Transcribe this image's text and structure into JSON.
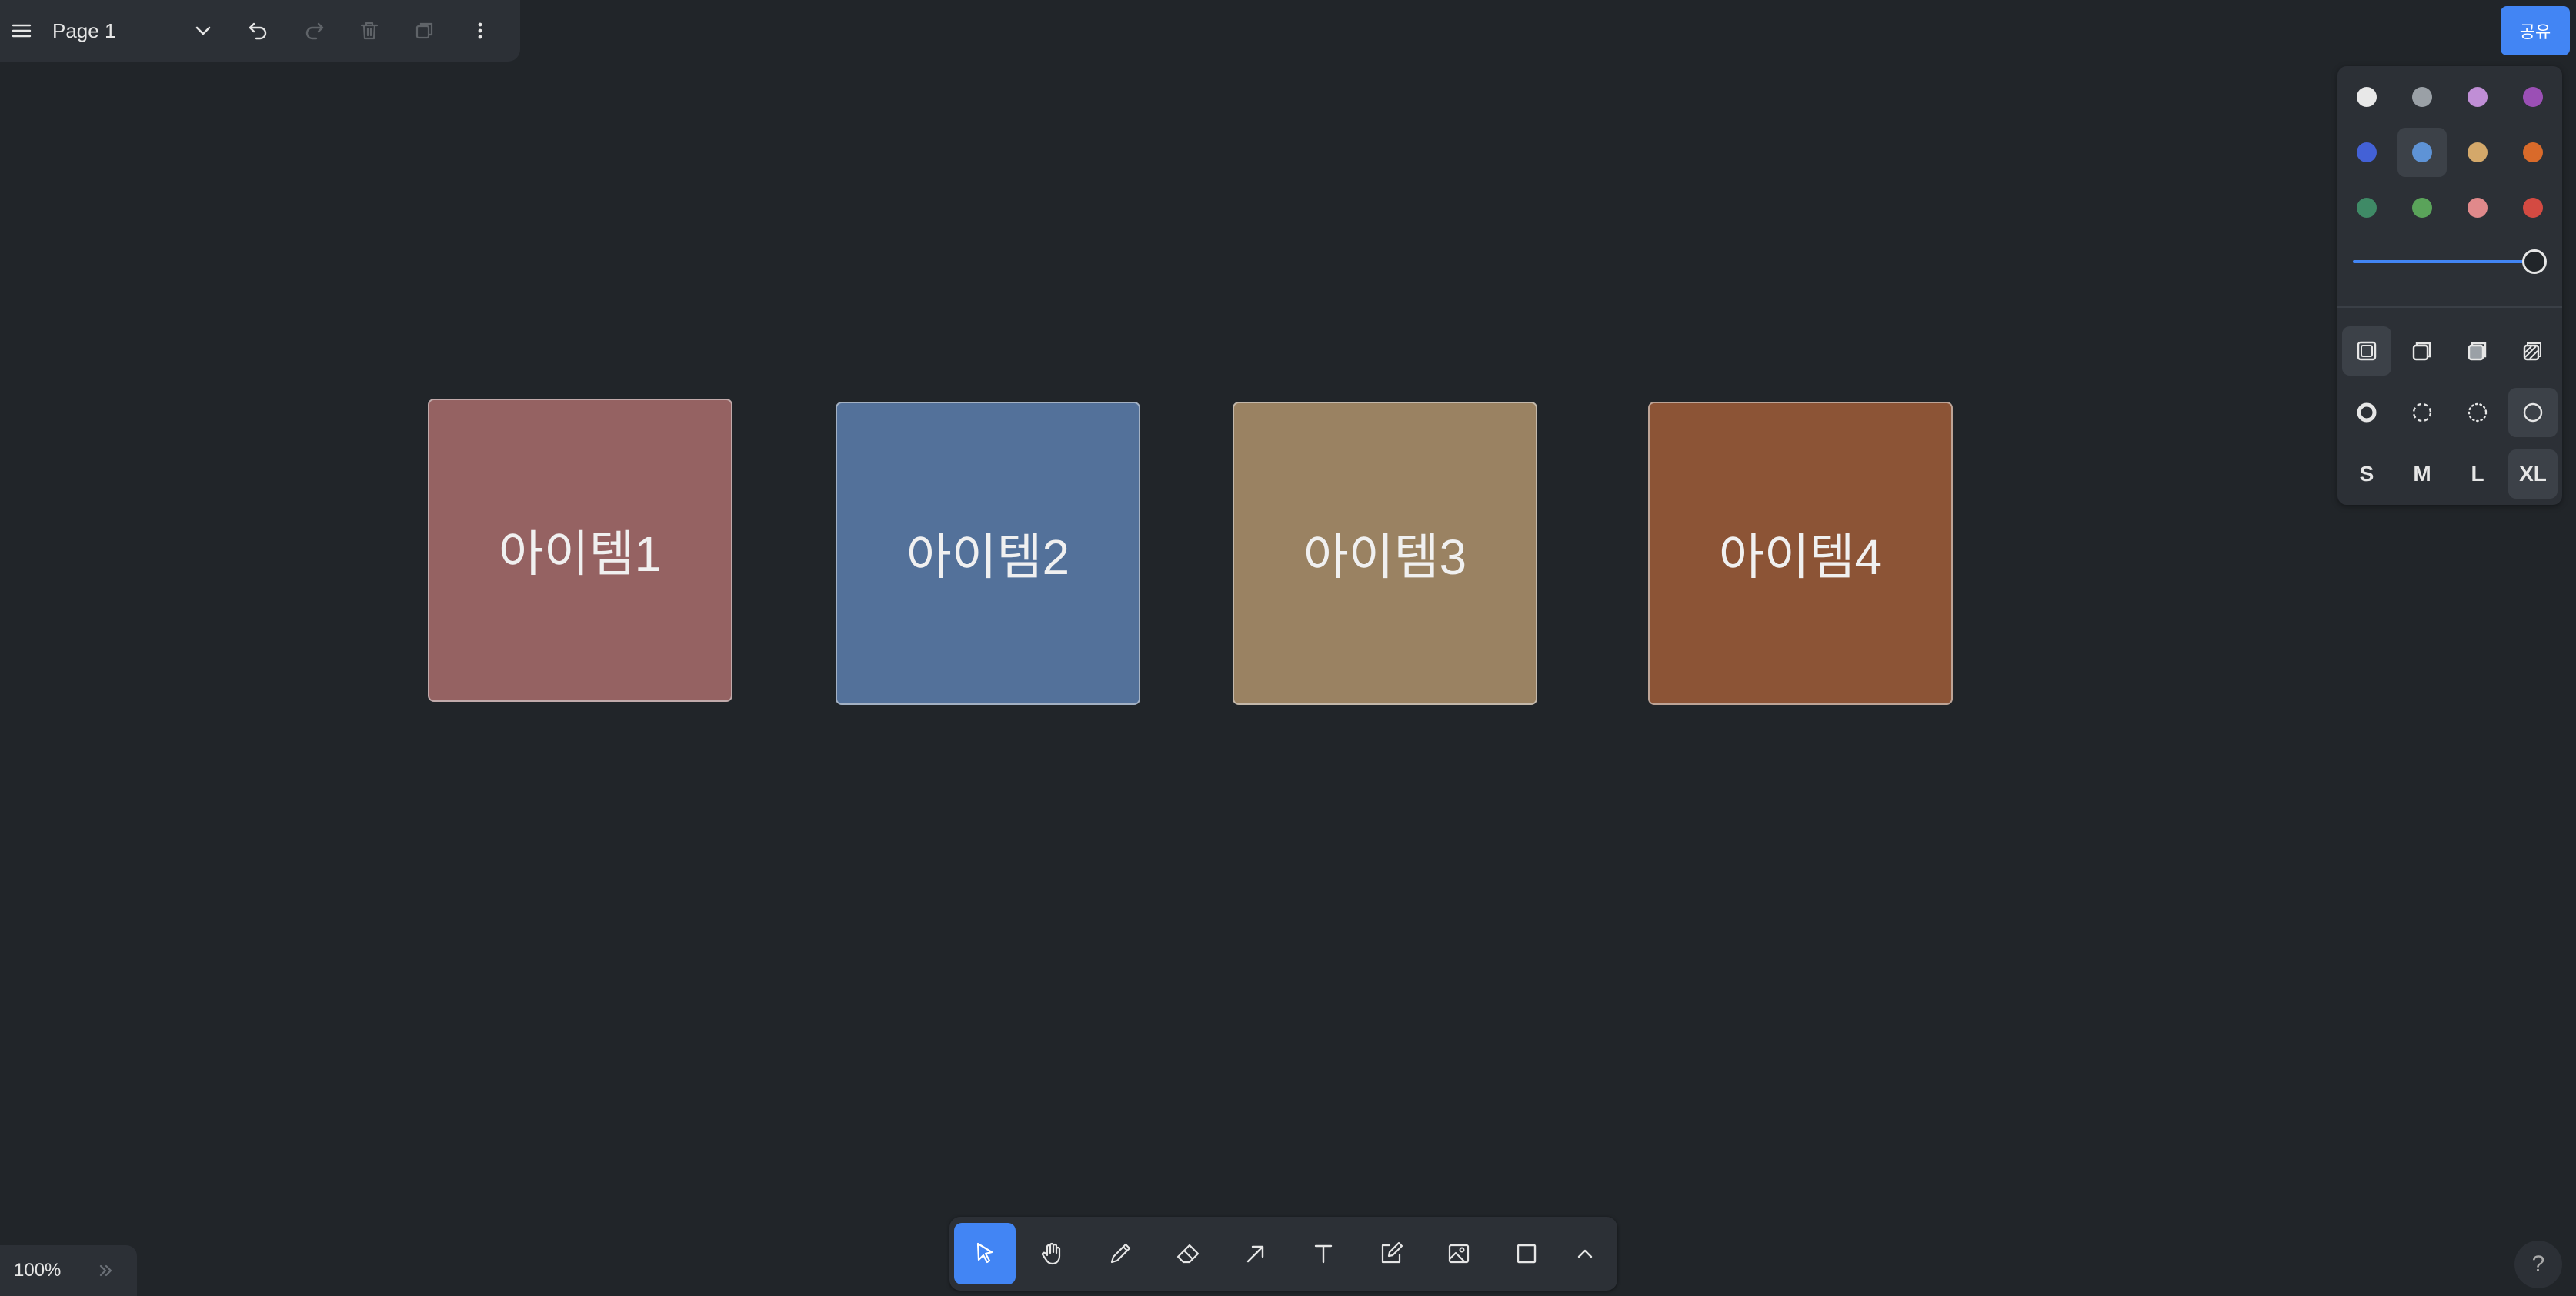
{
  "header": {
    "page_name": "Page 1",
    "share_label": "공유"
  },
  "style_panel": {
    "colors": [
      [
        "#e8e8e8",
        "#9aa0a6",
        "#c08ed6",
        "#9b4fb5"
      ],
      [
        "#4361d6",
        "#5e93d6",
        "#d4a86a",
        "#d96a2a"
      ],
      [
        "#3f8a66",
        "#5aa35a",
        "#e0898b",
        "#d44a42"
      ]
    ],
    "selected_color": "#5e93d6",
    "opacity_value": 1.0,
    "sizes": [
      "S",
      "M",
      "L",
      "XL"
    ],
    "selected_size": "XL"
  },
  "canvas": {
    "cards": [
      {
        "label": "아이템1",
        "color": "#956262"
      },
      {
        "label": "아이템2",
        "color": "#53719a"
      },
      {
        "label": "아이템3",
        "color": "#9a8262"
      },
      {
        "label": "아이템4",
        "color": "#8c5436"
      }
    ]
  },
  "toolbar": {
    "tools": [
      "select",
      "hand",
      "draw",
      "eraser",
      "arrow",
      "text",
      "note",
      "image",
      "rectangle",
      "more"
    ],
    "active_tool": "select"
  },
  "footer": {
    "zoom": "100%",
    "help": "?"
  }
}
